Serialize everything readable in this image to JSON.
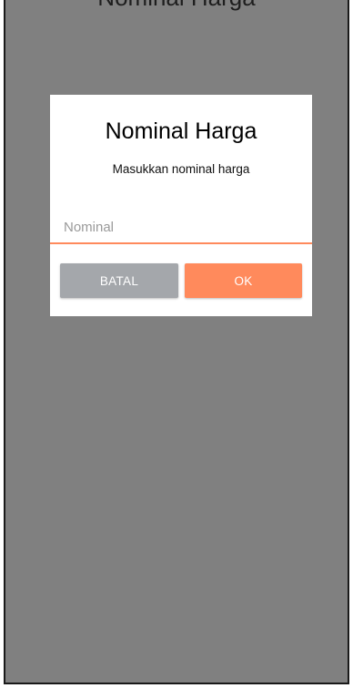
{
  "background": {
    "title_partial": "Nominal Harga"
  },
  "dialog": {
    "title": "Nominal Harga",
    "message": "Masukkan nominal harga",
    "input": {
      "placeholder": "Nominal",
      "value": ""
    },
    "buttons": {
      "cancel_label": "BATAL",
      "ok_label": "OK"
    }
  },
  "colors": {
    "accent": "#ff8a5c",
    "cancel": "#a4a7ab",
    "scrim": "#808080"
  }
}
